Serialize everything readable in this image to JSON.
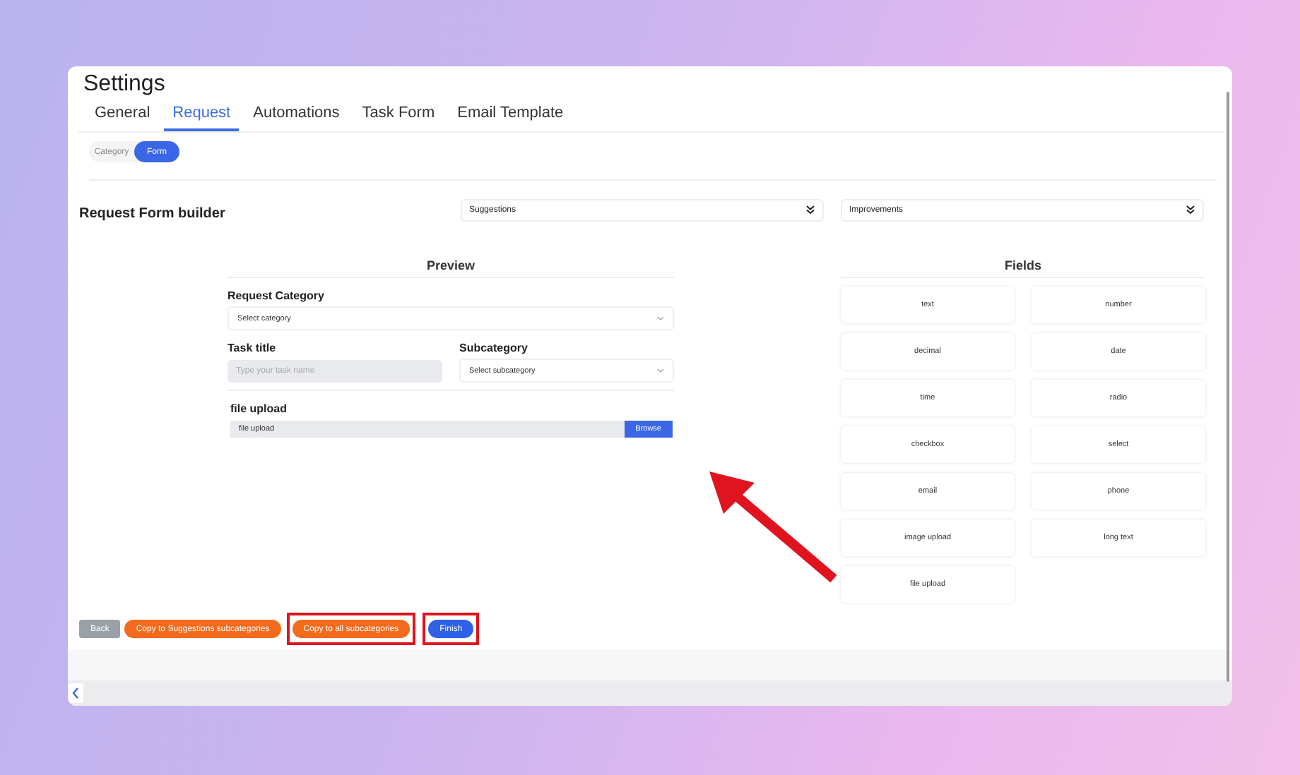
{
  "window": {
    "title": "Settings"
  },
  "tabs": [
    {
      "label": "General",
      "selected": false
    },
    {
      "label": "Request",
      "selected": true
    },
    {
      "label": "Automations",
      "selected": false
    },
    {
      "label": "Task Form",
      "selected": false
    },
    {
      "label": "Email Template",
      "selected": false
    }
  ],
  "segments": [
    {
      "label": "Category",
      "selected": false
    },
    {
      "label": "Form",
      "selected": true
    }
  ],
  "builder": {
    "title": "Request Form builder",
    "dropdowns": [
      {
        "label": "Suggestions"
      },
      {
        "label": "Improvements"
      }
    ]
  },
  "preview": {
    "title": "Preview",
    "category": {
      "label": "Request Category",
      "placeholder": "Select category"
    },
    "task_title": {
      "label": "Task title",
      "placeholder": "Type your task name"
    },
    "subcategory": {
      "label": "Subcategory",
      "placeholder": "Select subcategory"
    },
    "file_upload": {
      "label": "file upload",
      "placeholder": "file upload",
      "button": "Browse"
    }
  },
  "fields": {
    "title": "Fields",
    "items": [
      "text",
      "number",
      "decimal",
      "date",
      "time",
      "radio",
      "checkbox",
      "select",
      "email",
      "phone",
      "image upload",
      "long text",
      "file upload"
    ]
  },
  "buttons": [
    {
      "label": "Back",
      "kind": "neutral",
      "highlighted": false
    },
    {
      "label": "Copy to Suggestions subcategories",
      "kind": "accent",
      "highlighted": false
    },
    {
      "label": "Copy to all subcategories",
      "kind": "accent",
      "highlighted": true
    },
    {
      "label": "Finish",
      "kind": "primary",
      "highlighted": true
    }
  ]
}
